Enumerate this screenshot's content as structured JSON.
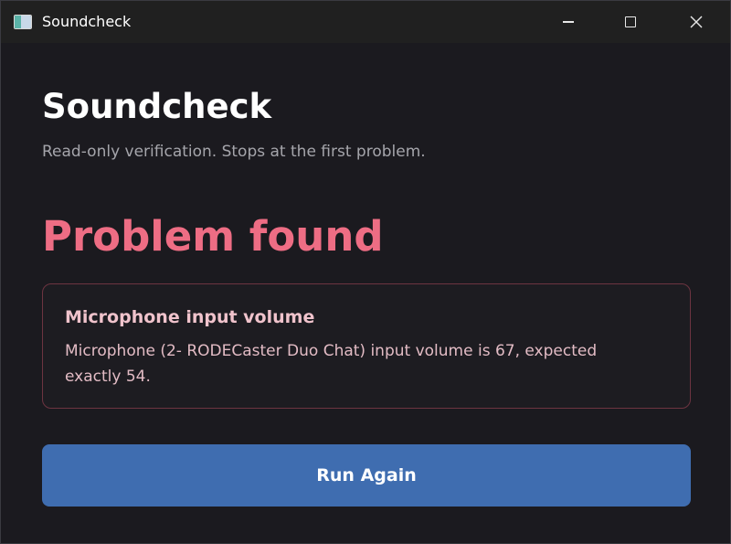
{
  "window": {
    "title": "Soundcheck"
  },
  "header": {
    "title": "Soundcheck",
    "subtitle": "Read-only verification. Stops at the first problem."
  },
  "status": {
    "text": "Problem found",
    "color": "#ee6d84"
  },
  "problem": {
    "title": "Microphone input volume",
    "description": "Microphone (2- RODECaster Duo Chat) input volume is 67, expected exactly 54."
  },
  "actions": {
    "run_again_label": "Run Again",
    "button_color": "#3f6db0"
  },
  "icons": {
    "app": "app-window-icon",
    "minimize": "minimize-icon",
    "maximize": "maximize-icon",
    "close": "close-icon"
  }
}
